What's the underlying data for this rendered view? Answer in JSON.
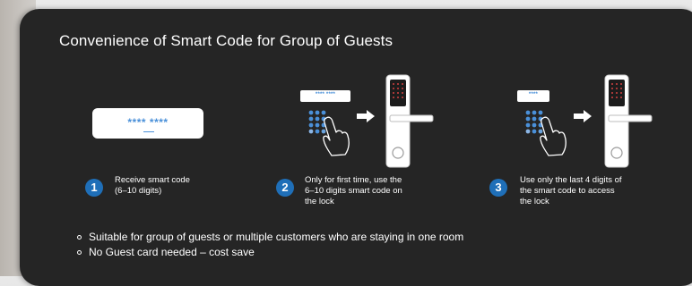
{
  "title": "Convenience of Smart Code for Group of Guests",
  "card": {
    "code": "****  ****"
  },
  "mini_cards": {
    "step2_code": "**** ****",
    "step3_code": "****"
  },
  "steps": [
    {
      "number": "1",
      "line1": "Receive smart code",
      "line2": "(6–10 digits)",
      "line3": ""
    },
    {
      "number": "2",
      "line1": "Only for first time, use the",
      "line2": "6–10 digits smart code on",
      "line3": "the lock"
    },
    {
      "number": "3",
      "line1": "Use only the last 4 digits of",
      "line2": "the smart code to access",
      "line3": "the lock"
    }
  ],
  "bullets": [
    "Suitable for group of guests or multiple customers who are staying in one room",
    "No Guest card needed – cost save"
  ],
  "icons": [
    "keypad-icon",
    "hand-icon",
    "arrow-right-icon",
    "door-lock-icon"
  ],
  "colors": {
    "panel": "#252525",
    "accent": "#1f6fb8",
    "code_text": "#4a90d9"
  }
}
